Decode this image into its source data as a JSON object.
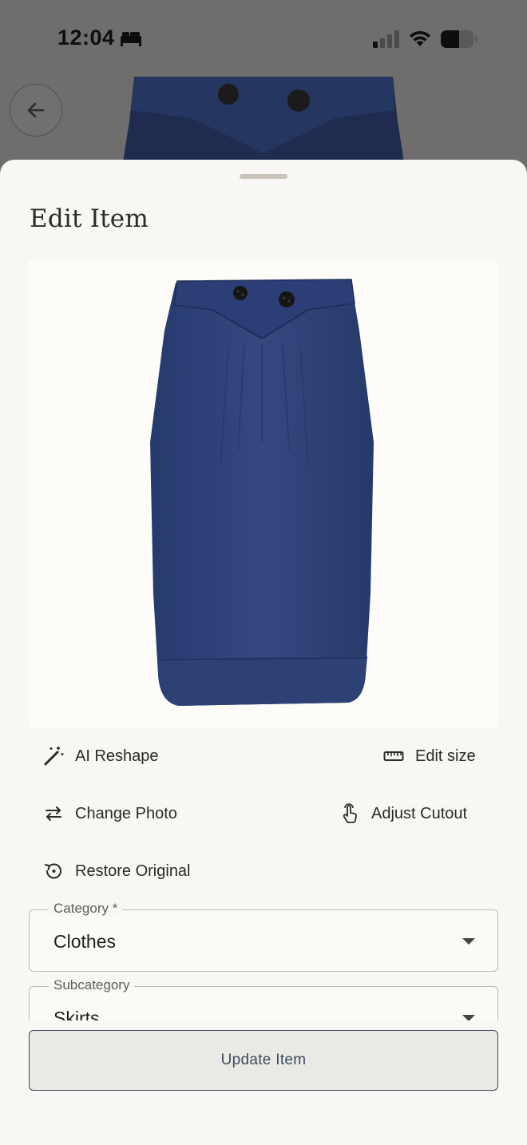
{
  "status_bar": {
    "time": "12:04",
    "icons": [
      "bed-icon",
      "cellular-signal-icon",
      "wifi-icon",
      "battery-icon"
    ]
  },
  "header": {
    "back_icon": "arrow-left-icon"
  },
  "sheet": {
    "title": "Edit Item",
    "image_alt": "navy-pencil-skirt-image"
  },
  "actions": {
    "ai_reshape": {
      "label": "AI Reshape",
      "icon": "magic-wand-icon"
    },
    "edit_size": {
      "label": "Edit size",
      "icon": "ruler-icon"
    },
    "change_photo": {
      "label": "Change Photo",
      "icon": "swap-arrows-icon"
    },
    "adjust_cutout": {
      "label": "Adjust Cutout",
      "icon": "touch-hand-icon"
    },
    "restore_original": {
      "label": "Restore Original",
      "icon": "history-icon"
    }
  },
  "form": {
    "category": {
      "label": "Category *",
      "value": "Clothes"
    },
    "subcategory": {
      "label": "Subcategory",
      "value": "Skirts"
    }
  },
  "footer": {
    "update_label": "Update Item"
  },
  "colors": {
    "sheet_bg": "#f8f7f3",
    "skirt_navy": "#2f4377",
    "button_border": "#3f4a5c"
  }
}
